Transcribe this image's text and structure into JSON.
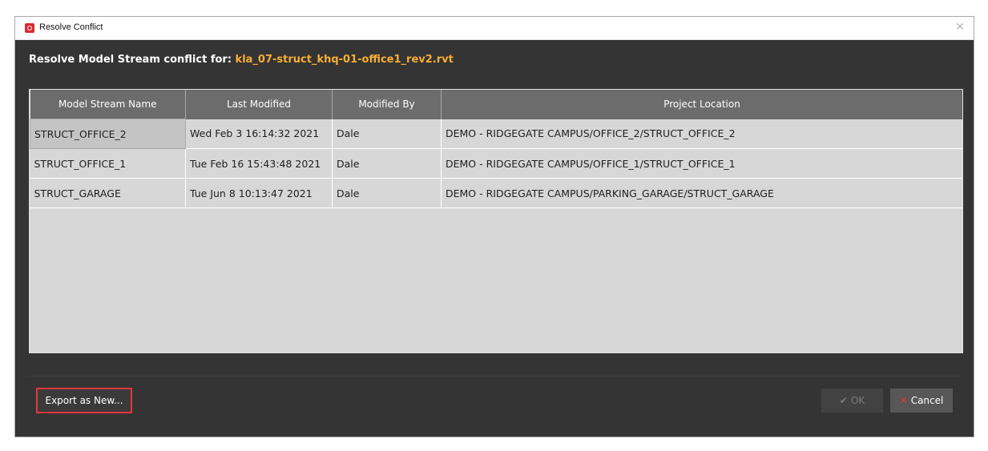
{
  "window": {
    "title": "Resolve Conflict",
    "close_symbol": "✕"
  },
  "header": {
    "prefix": "Resolve Model Stream conflict for: ",
    "filename": "kla_07-struct_khq-01-office1_rev2.rvt"
  },
  "table": {
    "columns": [
      "Model Stream Name",
      "Last Modified",
      "Modified By",
      "Project Location"
    ],
    "rows": [
      [
        "STRUCT_OFFICE_2",
        "Wed Feb 3 16:14:32 2021",
        "Dale",
        "DEMO - RIDGEGATE CAMPUS/OFFICE_2/STRUCT_OFFICE_2"
      ],
      [
        "STRUCT_OFFICE_1",
        "Tue Feb 16 15:43:48 2021",
        "Dale",
        "DEMO - RIDGEGATE CAMPUS/OFFICE_1/STRUCT_OFFICE_1"
      ],
      [
        "STRUCT_GARAGE",
        "Tue Jun 8 10:13:47 2021",
        "Dale",
        "DEMO - RIDGEGATE CAMPUS/PARKING_GARAGE/STRUCT_GARAGE"
      ]
    ]
  },
  "footer": {
    "export_label": "Export as New...",
    "ok_label": "OK",
    "cancel_label": "Cancel"
  },
  "icons": {
    "app": "app-logo-icon",
    "close": "close-icon",
    "ok": "checkmark-icon",
    "cancel": "x-icon"
  },
  "colors": {
    "accent_filename": "#f6ae35",
    "highlight_border": "#e5373e",
    "dialog_bg": "#343434"
  }
}
